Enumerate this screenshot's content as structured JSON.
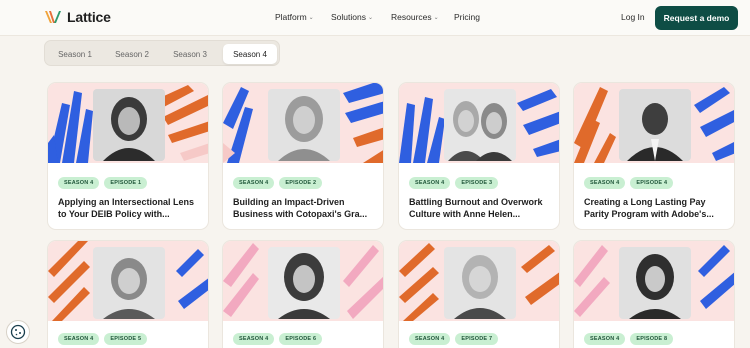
{
  "nav": {
    "logo_text": "Lattice",
    "links": [
      {
        "label": "Platform",
        "has_menu": true
      },
      {
        "label": "Solutions",
        "has_menu": true
      },
      {
        "label": "Resources",
        "has_menu": true
      },
      {
        "label": "Pricing",
        "has_menu": false
      }
    ],
    "login_label": "Log In",
    "demo_label": "Request a demo"
  },
  "tabs": [
    {
      "label": "Season 1",
      "active": false
    },
    {
      "label": "Season 2",
      "active": false
    },
    {
      "label": "Season 3",
      "active": false
    },
    {
      "label": "Season 4",
      "active": true
    }
  ],
  "cards": [
    {
      "season": "SEASON 4",
      "episode": "EPISODE 1",
      "title_line1": "Applying an Intersectional Lens",
      "title_line2": "to Your DEIB Policy with..."
    },
    {
      "season": "SEASON 4",
      "episode": "EPISODE 2",
      "title_line1": "Building an Impact-Driven",
      "title_line2": "Business with Cotopaxi's Gra..."
    },
    {
      "season": "SEASON 4",
      "episode": "EPISODE 3",
      "title_line1": "Battling Burnout and Overwork",
      "title_line2": "Culture with Anne Helen..."
    },
    {
      "season": "SEASON 4",
      "episode": "EPISODE 4",
      "title_line1": "Creating a Long Lasting Pay",
      "title_line2": "Parity Program with Adobe's..."
    },
    {
      "season": "SEASON 4",
      "episode": "EPISODE 5"
    },
    {
      "season": "SEASON 4",
      "episode": "EPISODE 6"
    },
    {
      "season": "SEASON 4",
      "episode": "EPISODE 7"
    },
    {
      "season": "SEASON 4",
      "episode": "EPISODE 8"
    }
  ],
  "colors": {
    "brand_dark_green": "#0e4d45",
    "badge_bg": "#c9efd2",
    "blue_shape": "#2f5fe0",
    "orange_shape": "#e06a2b",
    "pink_shape": "#f6c9c7"
  }
}
